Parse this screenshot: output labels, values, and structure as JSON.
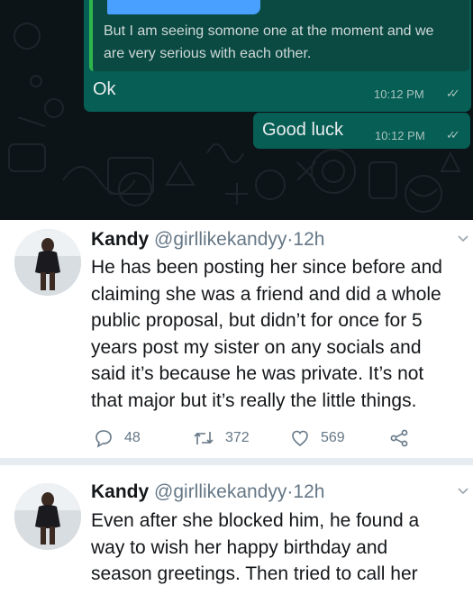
{
  "chat": {
    "quoted_message": "But I am seeing somone one at the moment and we are very serious with each other.",
    "reply": {
      "text": "Ok",
      "time": "10:12 PM"
    },
    "outgoing": {
      "text": "Good luck",
      "time": "10:12 PM"
    },
    "colors": {
      "background": "#0d1417",
      "bubble": "#075e54",
      "quote_bar": "#2fb54a"
    }
  },
  "tweets": [
    {
      "name": "Kandy",
      "handle": "@girllikekandyy",
      "separator": "·",
      "age": "12h",
      "text": "He has been posting her since before and\nclaiming she was a friend and did a whole\npublic proposal, but didn’t for once for 5\nyears post my sister on any socials and\nsaid it’s because he was private. It’s not\nthat major but it’s really the little things.",
      "replies": "48",
      "retweets": "372",
      "likes": "569"
    },
    {
      "name": "Kandy",
      "handle": "@girllikekandyy",
      "separator": "·",
      "age": "12h",
      "text": "Even after she blocked him, he found a\nway to wish her happy birthday and\nseason greetings. Then tried to call her"
    }
  ],
  "icons": {
    "reply": "reply-icon",
    "retweet": "retweet-icon",
    "like": "heart-icon",
    "share": "share-icon",
    "more": "chevron-down-icon"
  }
}
